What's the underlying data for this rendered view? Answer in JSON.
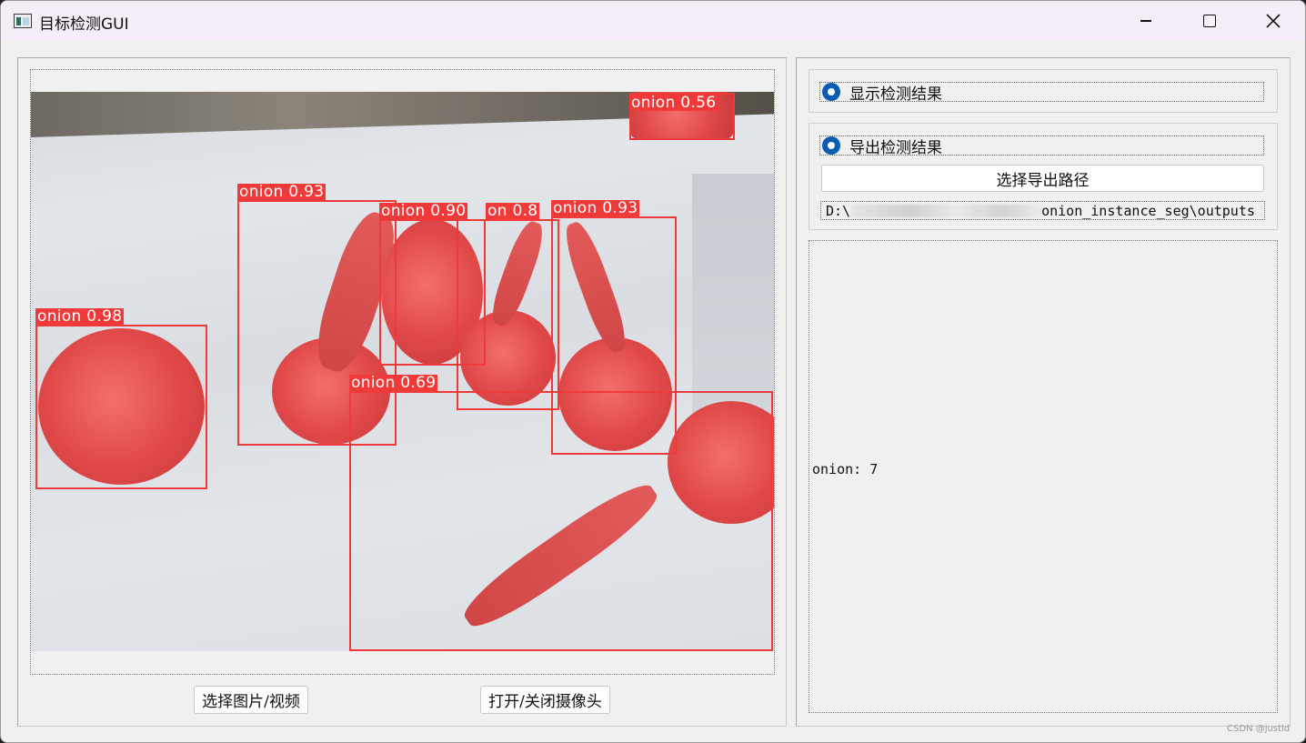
{
  "window": {
    "title": "目标检测GUI"
  },
  "image_view": {
    "detections": [
      {
        "label": "onion 0.56"
      },
      {
        "label": "onion 0.93"
      },
      {
        "label": "onion 0.90"
      },
      {
        "label": "on 0.8"
      },
      {
        "label": "onion 0.93"
      },
      {
        "label": "onion 0.98"
      },
      {
        "label": "onion 0.69"
      }
    ]
  },
  "buttons": {
    "select_media": "选择图片/视频",
    "toggle_camera": "打开/关闭摄像头",
    "select_export_path": "选择导出路径"
  },
  "options": {
    "show_results": "显示检测结果",
    "export_results": "导出检测结果"
  },
  "export": {
    "path_prefix": "D:\\",
    "path_suffix": "onion_instance_seg\\outputs"
  },
  "results": {
    "summary": "onion: 7"
  },
  "watermark": "CSDN @justld",
  "colors": {
    "bbox": "#f03a3a",
    "radio_checked": "#0a5bb4"
  }
}
